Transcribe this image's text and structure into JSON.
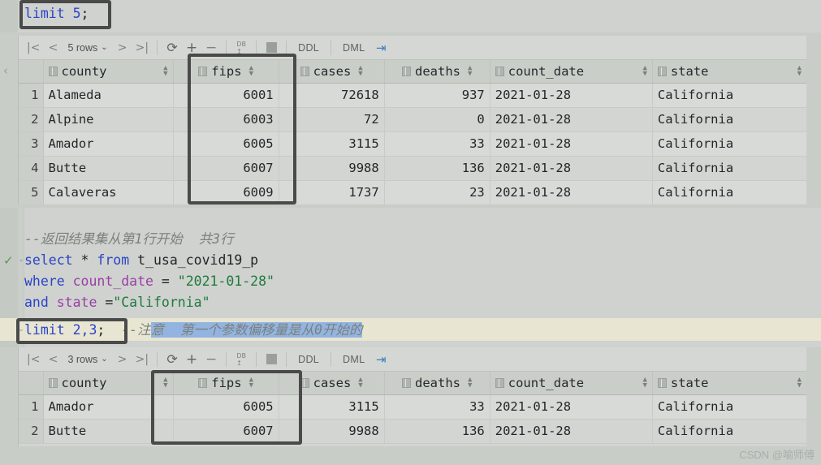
{
  "editor": {
    "top_line": {
      "keyword": "limit",
      "value": "5",
      "terminator": ";"
    },
    "comment_1": "--返回结果集从第1行开始  共3行",
    "line_select": {
      "kw1": "select",
      "star": "*",
      "kw2": "from",
      "table": "t_usa_covid19_p"
    },
    "line_where": {
      "kw": "where",
      "column": "count_date",
      "op": "=",
      "value": "\"2021-01-28\""
    },
    "line_and": {
      "kw": "and",
      "column": "state",
      "op": "=",
      "value": "\"California\""
    },
    "line_limit": {
      "kw": "limit",
      "args": "2,3",
      "terminator": ";"
    },
    "trailing_comment_plain": "--注",
    "trailing_comment_selected": "意  第一个参数偏移量是从0开始的"
  },
  "colors": {
    "keyword": "#2b43c8",
    "column": "#9b3ea8",
    "string": "#1f7a3d",
    "comment": "#7b807d",
    "selection": "#93b4e0",
    "highlight_box": "#4a4a4a",
    "current_line": "#e8e6d2",
    "background": "#c9cdc8",
    "grid_header": "#cacec9",
    "accent_link": "#3f7fbf"
  },
  "result_grid_1": {
    "toolbar": {
      "first_page_icon": "first-page-icon",
      "prev_page_icon": "prev-page-icon",
      "row_count_label": "5 rows",
      "row_count_chevron": "chevron-down-icon",
      "next_page_icon": "next-page-icon",
      "last_page_icon": "last-page-icon",
      "refresh_icon": "refresh-icon",
      "add_row_icon": "plus-icon",
      "delete_row_icon": "minus-icon",
      "db_export_icon": "db-upload-icon",
      "stop_icon": "stop-icon",
      "ddl_label": "DDL",
      "dml_label": "DML",
      "transpose_icon": "transpose-icon"
    },
    "columns": [
      "county",
      "fips",
      "cases",
      "deaths",
      "count_date",
      "state"
    ],
    "rows": [
      {
        "n": "1",
        "county": "Alameda",
        "fips": "6001",
        "cases": "72618",
        "deaths": "937",
        "count_date": "2021-01-28",
        "state": "California"
      },
      {
        "n": "2",
        "county": "Alpine",
        "fips": "6003",
        "cases": "72",
        "deaths": "0",
        "count_date": "2021-01-28",
        "state": "California"
      },
      {
        "n": "3",
        "county": "Amador",
        "fips": "6005",
        "cases": "3115",
        "deaths": "33",
        "count_date": "2021-01-28",
        "state": "California"
      },
      {
        "n": "4",
        "county": "Butte",
        "fips": "6007",
        "cases": "9988",
        "deaths": "136",
        "count_date": "2021-01-28",
        "state": "California"
      },
      {
        "n": "5",
        "county": "Calaveras",
        "fips": "6009",
        "cases": "1737",
        "deaths": "23",
        "count_date": "2021-01-28",
        "state": "California"
      }
    ]
  },
  "result_grid_2": {
    "toolbar": {
      "first_page_icon": "first-page-icon",
      "prev_page_icon": "prev-page-icon",
      "row_count_label": "3 rows",
      "row_count_chevron": "chevron-down-icon",
      "next_page_icon": "next-page-icon",
      "last_page_icon": "last-page-icon",
      "refresh_icon": "refresh-icon",
      "add_row_icon": "plus-icon",
      "delete_row_icon": "minus-icon",
      "db_export_icon": "db-upload-icon",
      "stop_icon": "stop-icon",
      "ddl_label": "DDL",
      "dml_label": "DML",
      "transpose_icon": "transpose-icon"
    },
    "columns": [
      "county",
      "fips",
      "cases",
      "deaths",
      "count_date",
      "state"
    ],
    "rows": [
      {
        "n": "1",
        "county": "Amador",
        "fips": "6005",
        "cases": "3115",
        "deaths": "33",
        "count_date": "2021-01-28",
        "state": "California"
      },
      {
        "n": "2",
        "county": "Butte",
        "fips": "6007",
        "cases": "9988",
        "deaths": "136",
        "count_date": "2021-01-28",
        "state": "California"
      }
    ]
  },
  "watermark": "CSDN @喻师傅"
}
